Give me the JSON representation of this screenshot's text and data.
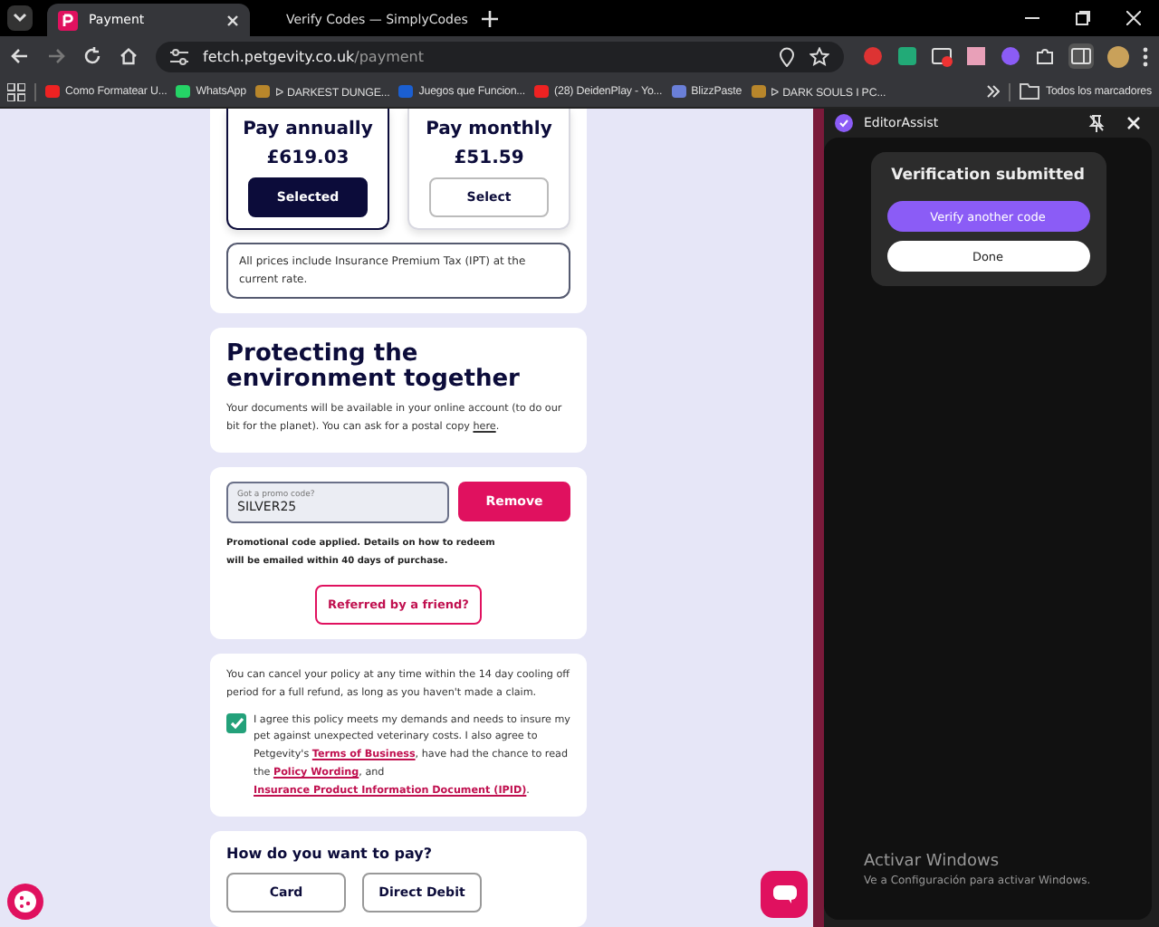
{
  "browser": {
    "tabs": [
      {
        "title": "Payment",
        "selected": true
      },
      {
        "title": "Verify Codes — SimplyCodes",
        "selected": false
      }
    ],
    "url": {
      "host": "fetch.petgevity.co.uk",
      "path": "/payment"
    },
    "bookmarks": [
      "Como Formatear U...",
      "WhatsApp",
      "ᐅ DARKEST DUNGE...",
      "Juegos que Funcion...",
      "(28) DeidenPlay - Yo...",
      "BlizzPaste",
      "ᐅ DARK SOULS I PC..."
    ],
    "all_bookmarks": "Todos los marcadores"
  },
  "page": {
    "plans": [
      {
        "title": "Pay annually",
        "price": "£619.03",
        "button": "Selected",
        "selected": true
      },
      {
        "title": "Pay monthly",
        "price": "£51.59",
        "button": "Select",
        "selected": false
      }
    ],
    "tax_note": "All prices include Insurance Premium Tax (IPT) at the current rate.",
    "environment": {
      "heading": "Protecting the environment together",
      "text": "Your documents will be available in your online account (to do our bit for the planet). You can ask for a postal copy ",
      "link": "here",
      "end": "."
    },
    "promo": {
      "label": "Got a promo code?",
      "value": "SILVER25",
      "button": "Remove",
      "note": "Promotional code applied. Details on how to redeem will be emailed within 40 days of purchase.",
      "referral": "Referred by a friend?"
    },
    "terms": {
      "text": "You can cancel your policy at any time within the 14 day cooling off period for a full refund, as long as you haven't made a claim.",
      "agreed": true,
      "agreement": [
        {
          "kind": "text",
          "text": "I agree this policy meets my demands and needs to insure my pet against unexpected veterinary costs. I also agree to Petgevity's "
        },
        {
          "kind": "link",
          "text": "Terms of Business"
        },
        {
          "kind": "text",
          "text": ", have had the chance to read the "
        },
        {
          "kind": "link",
          "text": "Policy Wording"
        },
        {
          "kind": "text",
          "text": ", and "
        },
        {
          "kind": "link",
          "text": "Insurance Product Information Document (IPID)"
        },
        {
          "kind": "text",
          "text": "."
        }
      ]
    },
    "payment": {
      "question": "How do you want to pay?",
      "options": [
        "Card",
        "Direct Debit"
      ]
    }
  },
  "side_panel": {
    "title": "EditorAssist",
    "card": {
      "title": "Verification submitted",
      "buttons": [
        {
          "label": "Verify another code",
          "kind": "primary"
        },
        {
          "label": "Done",
          "kind": "secondary"
        }
      ]
    }
  },
  "os_notice": {
    "title": "Activar Windows",
    "text": "Ve a Configuración para activar Windows."
  }
}
